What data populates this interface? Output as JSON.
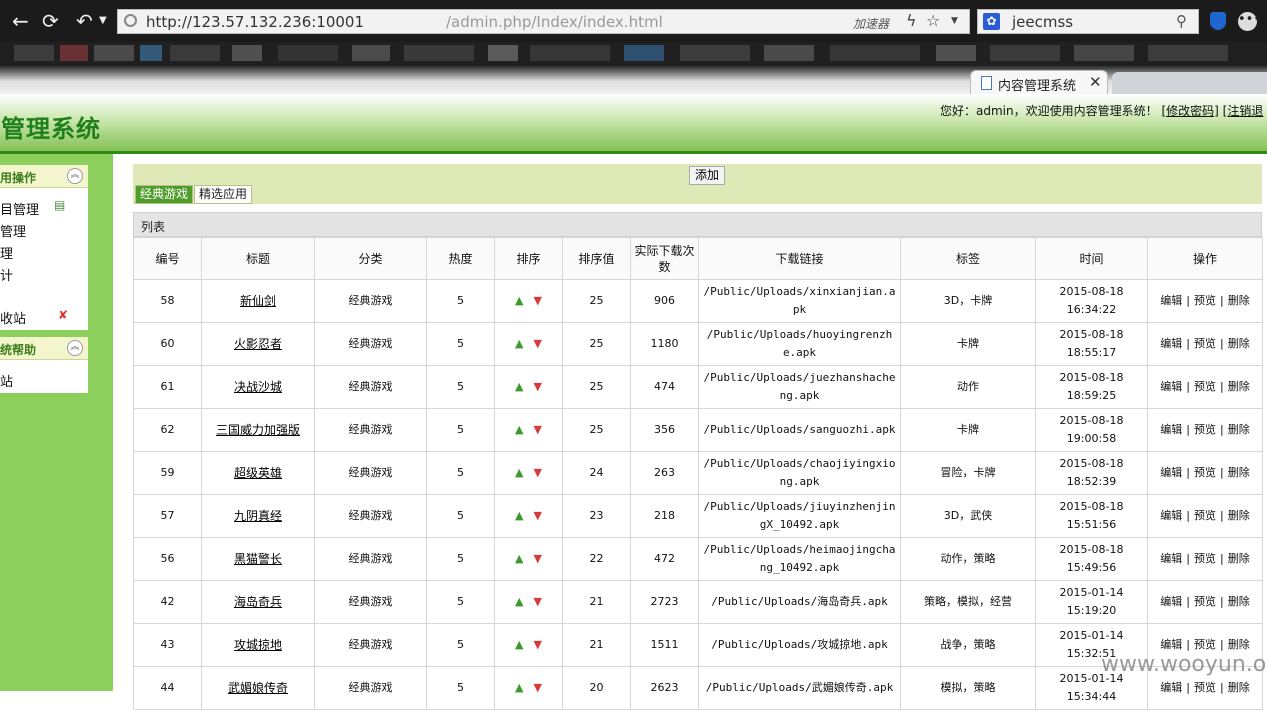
{
  "browser": {
    "url_host": "http://123.57.132.236:10001",
    "url_path": "/admin.php/Index/index.html",
    "accelerator_label": "加速器",
    "search_text": "jeecmss",
    "tab_title": "内容管理系统"
  },
  "header": {
    "app_title": "管理系统",
    "welcome_text": "您好：admin，欢迎使用内容管理系统！",
    "change_password": "[修改密码]",
    "logout": "[注销退"
  },
  "sidebar": {
    "panel1_title": "用操作",
    "items": [
      "目管理",
      "管理",
      "理",
      "计",
      "收站"
    ],
    "panel2_title": "统帮助",
    "help_items": [
      "站"
    ]
  },
  "toolbar": {
    "add_label": "添加",
    "tabs": [
      "经典游戏",
      "精选应用"
    ],
    "list_label": "列表"
  },
  "table": {
    "headers": [
      "编号",
      "标题",
      "分类",
      "热度",
      "排序",
      "排序值",
      "实际下载次数",
      "下载链接",
      "标签",
      "时间",
      "操作"
    ],
    "rows": [
      {
        "id": "58",
        "title": "新仙剑",
        "category": "经典游戏",
        "heat": "5",
        "sort_value": "25",
        "downloads": "906",
        "link": "/Public/Uploads/xinxianjian.apk",
        "tags": "3D，卡牌",
        "time": "2015-08-18 16:34:22"
      },
      {
        "id": "60",
        "title": "火影忍者",
        "category": "经典游戏",
        "heat": "5",
        "sort_value": "25",
        "downloads": "1180",
        "link": "/Public/Uploads/huoyingrenzhe.apk",
        "tags": "卡牌",
        "time": "2015-08-18 18:55:17"
      },
      {
        "id": "61",
        "title": "决战沙城",
        "category": "经典游戏",
        "heat": "5",
        "sort_value": "25",
        "downloads": "474",
        "link": "/Public/Uploads/juezhanshacheng.apk",
        "tags": "动作",
        "time": "2015-08-18 18:59:25"
      },
      {
        "id": "62",
        "title": "三国威力加强版",
        "category": "经典游戏",
        "heat": "5",
        "sort_value": "25",
        "downloads": "356",
        "link": "/Public/Uploads/sanguozhi.apk",
        "tags": "卡牌",
        "time": "2015-08-18 19:00:58"
      },
      {
        "id": "59",
        "title": "超级英雄",
        "category": "经典游戏",
        "heat": "5",
        "sort_value": "24",
        "downloads": "263",
        "link": "/Public/Uploads/chaojiyingxiong.apk",
        "tags": "冒险，卡牌",
        "time": "2015-08-18 18:52:39"
      },
      {
        "id": "57",
        "title": "九阴真经",
        "category": "经典游戏",
        "heat": "5",
        "sort_value": "23",
        "downloads": "218",
        "link": "/Public/Uploads/jiuyinzhenjingX_10492.apk",
        "tags": "3D，武侠",
        "time": "2015-08-18 15:51:56"
      },
      {
        "id": "56",
        "title": "黑猫警长",
        "category": "经典游戏",
        "heat": "5",
        "sort_value": "22",
        "downloads": "472",
        "link": "/Public/Uploads/heimaojingchang_10492.apk",
        "tags": "动作，策略",
        "time": "2015-08-18 15:49:56"
      },
      {
        "id": "42",
        "title": "海岛奇兵",
        "category": "经典游戏",
        "heat": "5",
        "sort_value": "21",
        "downloads": "2723",
        "link": "/Public/Uploads/海岛奇兵.apk",
        "tags": "策略，模拟，经营",
        "time": "2015-01-14 15:19:20"
      },
      {
        "id": "43",
        "title": "攻城掠地",
        "category": "经典游戏",
        "heat": "5",
        "sort_value": "21",
        "downloads": "1511",
        "link": "/Public/Uploads/攻城掠地.apk",
        "tags": "战争，策略",
        "time": "2015-01-14 15:32:51"
      },
      {
        "id": "44",
        "title": "武媚娘传奇",
        "category": "经典游戏",
        "heat": "5",
        "sort_value": "20",
        "downloads": "2623",
        "link": "/Public/Uploads/武媚娘传奇.apk",
        "tags": "模拟，策略",
        "time": "2015-01-14 15:34:44"
      }
    ],
    "ops": [
      "编辑",
      "|",
      "预览",
      "|",
      "删除"
    ],
    "up_icon": "▲",
    "down_icon": "▼"
  },
  "watermark": "www.wooyun.org",
  "colors": {
    "header_green": "#7fbf50",
    "title_green": "#1f7f1a",
    "sidebar_green": "#8ccf5c",
    "toolbar_bg": "#dfe9b8",
    "active_tab": "#4f9d2a"
  }
}
